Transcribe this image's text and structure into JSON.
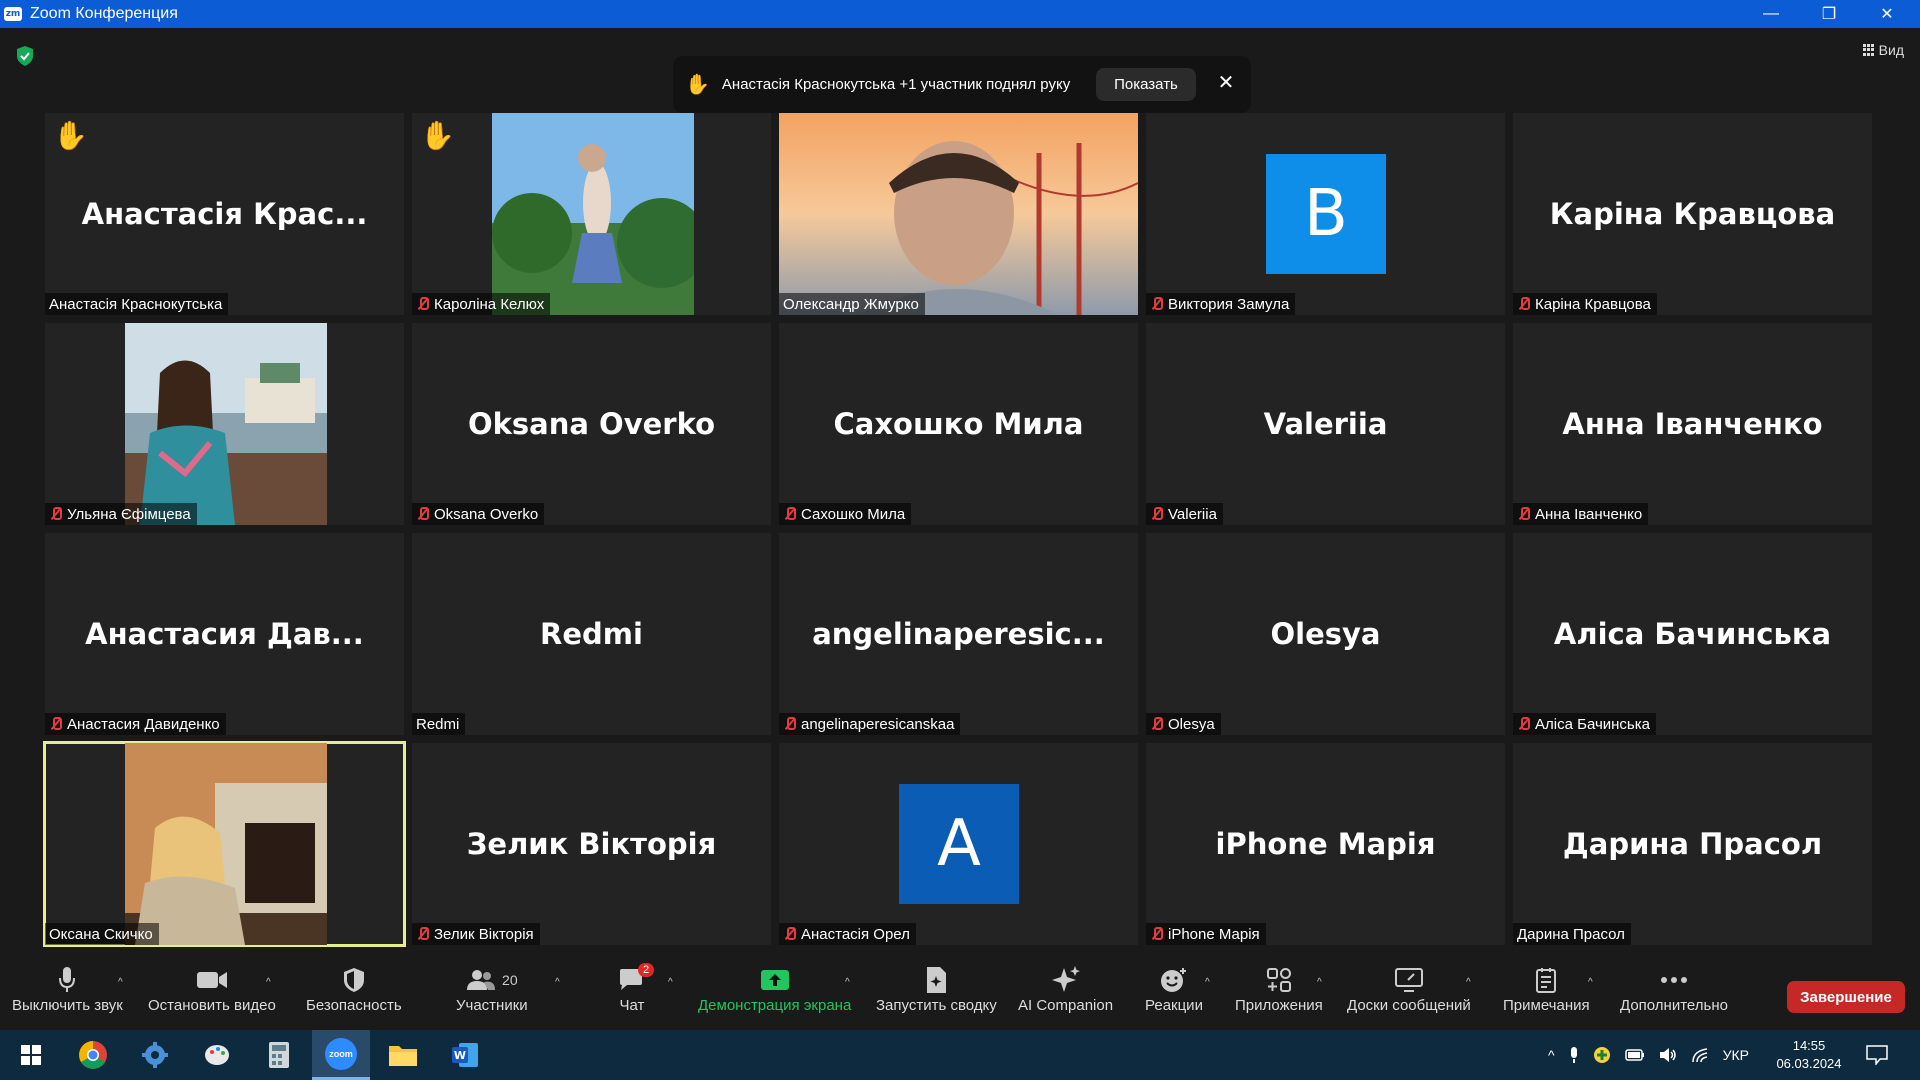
{
  "window": {
    "app_icon_text": "zm",
    "title": "Zoom Конференция",
    "minimize": "—",
    "restore": "❐",
    "close": "✕"
  },
  "view_button": "Вид",
  "notification": {
    "message": "Анастасія Краснокутська +1 участник поднял руку",
    "show_label": "Показать",
    "close": "✕"
  },
  "tiles": [
    {
      "big": "Анастасія  Крас...",
      "label": "Анастасія Краснокутська",
      "muted": false,
      "hand": true,
      "type": "name"
    },
    {
      "big": "",
      "label": "Кароліна Келюх",
      "muted": true,
      "hand": true,
      "type": "video"
    },
    {
      "big": "",
      "label": "Олександр Жмурко",
      "muted": false,
      "hand": false,
      "type": "video"
    },
    {
      "big": "",
      "label": "Виктория Замула",
      "muted": true,
      "hand": false,
      "type": "avatar",
      "avatar_letter": "B",
      "avatar_color": "#0e8ee9"
    },
    {
      "big": "Каріна Кравцова",
      "label": "Каріна Кравцова",
      "muted": true,
      "hand": false,
      "type": "name"
    },
    {
      "big": "",
      "label": "Ульяна Єфімцева",
      "muted": true,
      "hand": false,
      "type": "video"
    },
    {
      "big": "Oksana Overko",
      "label": "Oksana Overko",
      "muted": true,
      "hand": false,
      "type": "name"
    },
    {
      "big": "Сахошко Мила",
      "label": "Сахошко Мила",
      "muted": true,
      "hand": false,
      "type": "name"
    },
    {
      "big": "Valeriia",
      "label": "Valeriia",
      "muted": true,
      "hand": false,
      "type": "name"
    },
    {
      "big": "Анна Іванченко",
      "label": "Анна Іванченко",
      "muted": true,
      "hand": false,
      "type": "name"
    },
    {
      "big": "Анастасия  Дав...",
      "label": "Анастасия Давиденко",
      "muted": true,
      "hand": false,
      "type": "name"
    },
    {
      "big": "Redmi",
      "label": "Redmi",
      "muted": false,
      "hand": false,
      "type": "name"
    },
    {
      "big": "angelinaperesic...",
      "label": "angelinaperesicanskaa",
      "muted": true,
      "hand": false,
      "type": "name"
    },
    {
      "big": "Olesya",
      "label": "Olesya",
      "muted": true,
      "hand": false,
      "type": "name"
    },
    {
      "big": "Аліса Бачинська",
      "label": "Аліса Бачинська",
      "muted": true,
      "hand": false,
      "type": "name"
    },
    {
      "big": "",
      "label": "Оксана Скичко",
      "muted": false,
      "hand": false,
      "type": "video",
      "active": true
    },
    {
      "big": "Зелик Вікторія",
      "label": "Зелик Вікторія",
      "muted": true,
      "hand": false,
      "type": "name"
    },
    {
      "big": "",
      "label": "Анастасія Орел",
      "muted": true,
      "hand": false,
      "type": "avatar",
      "avatar_letter": "A",
      "avatar_color": "#0b5cb5"
    },
    {
      "big": "iPhone Марія",
      "label": "iPhone Марія",
      "muted": true,
      "hand": false,
      "type": "name"
    },
    {
      "big": "Дарина Прасол",
      "label": "Дарина Прасол",
      "muted": false,
      "hand": false,
      "type": "name"
    }
  ],
  "toolbar": {
    "mute": "Выключить звук",
    "video": "Остановить видео",
    "security": "Безопасность",
    "participants": "Участники",
    "participants_count": "20",
    "chat": "Чат",
    "chat_badge": "2",
    "share": "Демонстрация экрана",
    "summary": "Запустить сводку",
    "ai": "AI Companion",
    "reactions": "Реакции",
    "apps": "Приложения",
    "whiteboards": "Доски сообщений",
    "notes": "Примечания",
    "more": "Дополнительно",
    "end": "Завершение",
    "share_color": "#22c55e"
  },
  "taskbar": {
    "language": "УКР",
    "time": "14:55",
    "date": "06.03.2024",
    "zoom_label": "zoom"
  }
}
